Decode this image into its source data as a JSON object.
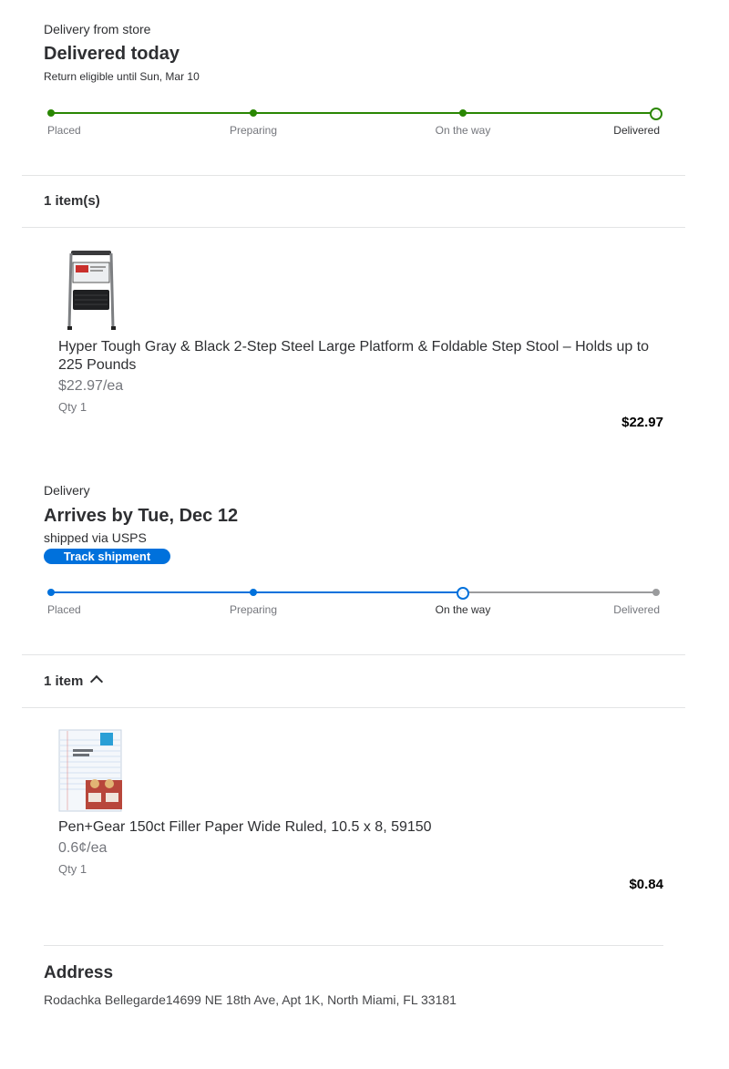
{
  "section1": {
    "mode": "Delivery from store",
    "status": "Delivered today",
    "return_note": "Return eligible until Sun, Mar 10",
    "tracker": {
      "color": "#2a8703",
      "current_step": 3,
      "steps": [
        "Placed",
        "Preparing",
        "On the way",
        "Delivered"
      ]
    },
    "items_header": "1 item(s)",
    "product": {
      "image_icon": "step-stool-image",
      "name_line1": "Hyper Tough Gray & Black 2-Step Steel Large Platform & Foldable Step Stool – Holds up to",
      "name_line2": "225 Pounds",
      "unit_price": "$22.97/ea",
      "qty": "Qty 1",
      "price": "$22.97"
    }
  },
  "section2": {
    "mode": "Delivery",
    "status": "Arrives by Tue, Dec 12",
    "carrier": "shipped via USPS",
    "track_button": "Track shipment",
    "tracker": {
      "color": "#0071dc",
      "pending_color": "#9a9b9d",
      "current_step": 2,
      "steps": [
        "Placed",
        "Preparing",
        "On the way",
        "Delivered"
      ]
    },
    "items_header": "1 item",
    "product": {
      "image_icon": "filler-paper-image",
      "name": "Pen+Gear 150ct Filler Paper Wide Ruled, 10.5 x 8, 59150",
      "unit_price": "0.6¢/ea",
      "qty": "Qty 1",
      "price": "$0.84"
    }
  },
  "address": {
    "heading": "Address",
    "text": "Rodachka Bellegarde14699 NE 18th Ave, Apt 1K, North Miami, FL 33181"
  }
}
